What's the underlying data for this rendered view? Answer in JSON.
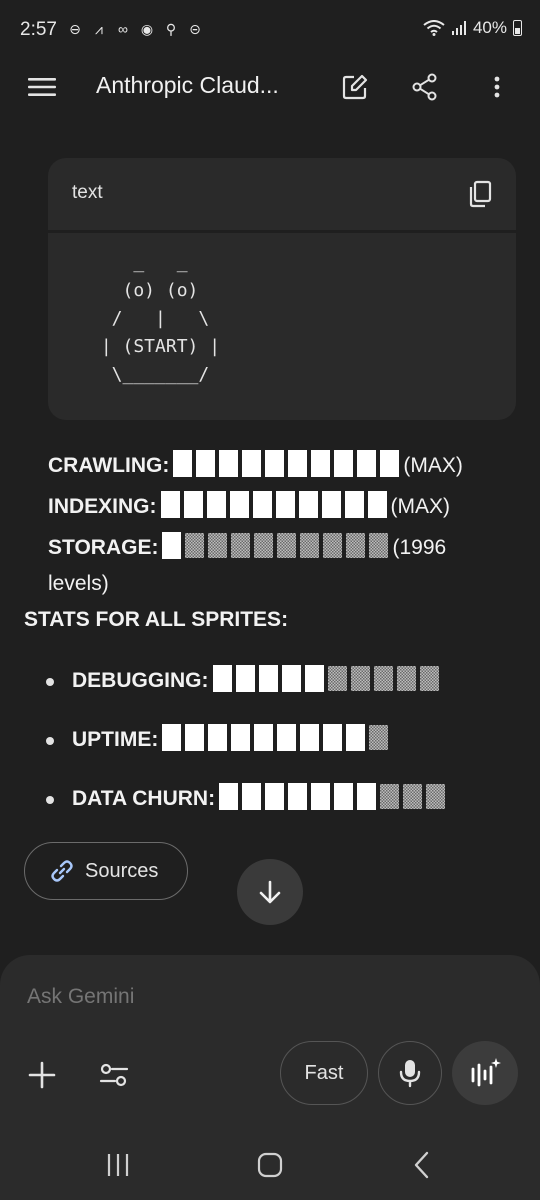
{
  "status_bar": {
    "time": "2:57",
    "battery": "40%",
    "icons": [
      "minus-circle-icon",
      "signal-wave-icon",
      "voicemail-icon",
      "location-icon",
      "pin-icon",
      "do-not-disturb-icon"
    ]
  },
  "app_bar": {
    "title": "Anthropic Claud...",
    "icons": [
      "menu-icon",
      "edit-icon",
      "share-icon",
      "more-vert-icon"
    ]
  },
  "code_block": {
    "language": "text",
    "content": "    _   _\n   (o) (o)\n  /   |   \\\n | (START) |\n  \\_______/"
  },
  "stats": [
    {
      "label": "CRAWLING:",
      "filled": 10,
      "shaded": 0,
      "suffix": "(MAX)"
    },
    {
      "label": "INDEXING:",
      "filled": 10,
      "shaded": 0,
      "suffix": "(MAX)"
    },
    {
      "label": "STORAGE:",
      "filled": 1,
      "shaded": 9,
      "suffix": "(1996"
    }
  ],
  "storage_wrap": "levels)",
  "section_heading": "STATS FOR ALL SPRITES:",
  "sprite_stats": [
    {
      "label": "DEBUGGING:",
      "filled": 5,
      "shaded": 5
    },
    {
      "label": "UPTIME:",
      "filled": 9,
      "shaded": 1
    },
    {
      "label": "DATA CHURN:",
      "filled": 7,
      "shaded": 3
    }
  ],
  "sources_label": "Sources",
  "composer": {
    "placeholder": "Ask Gemini",
    "fast_label": "Fast"
  },
  "colors": {
    "background": "#1f1f1f",
    "code_block": "#2a2a2a",
    "composer": "#2b2b2b",
    "link_accent": "#a8c7fa"
  }
}
